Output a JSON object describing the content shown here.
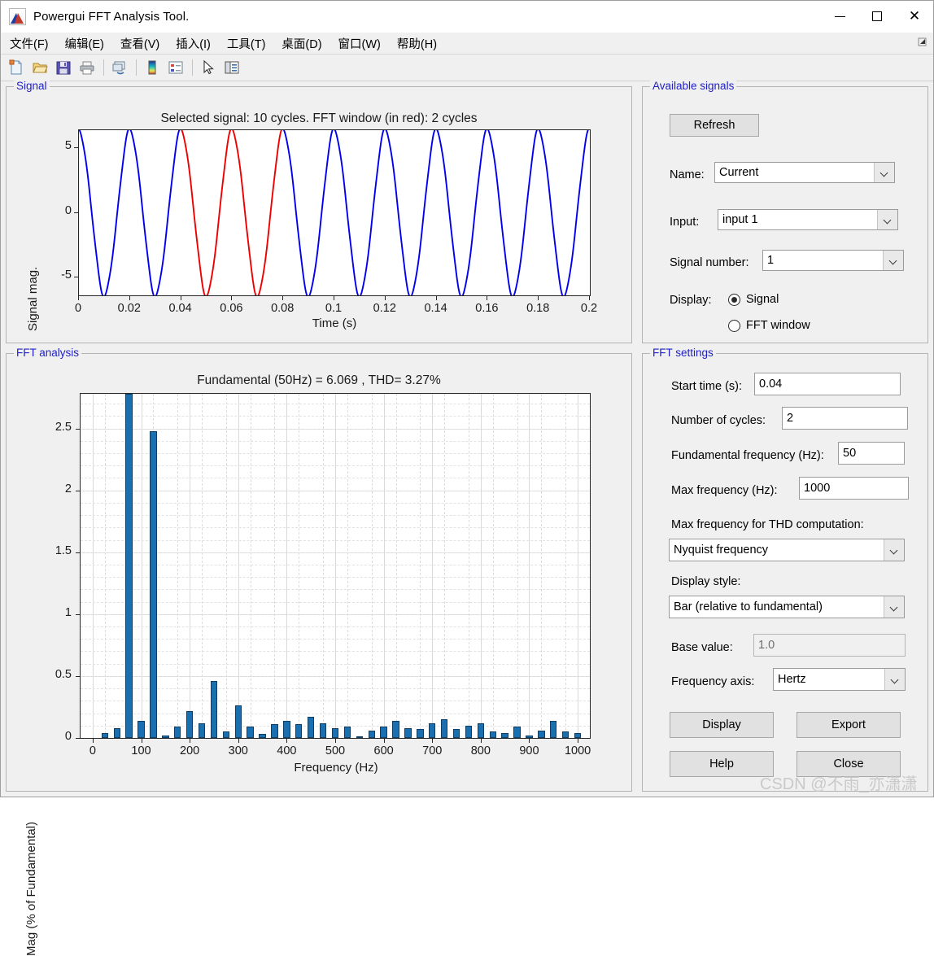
{
  "window": {
    "title": "Powergui FFT Analysis Tool.",
    "app_icon": "matlab-icon",
    "minimize": "minimize-icon",
    "maximize": "maximize-icon",
    "close": "close-icon"
  },
  "menubar": {
    "items": [
      {
        "label": "文件(F)",
        "mnemonic": "F"
      },
      {
        "label": "编辑(E)",
        "mnemonic": "E"
      },
      {
        "label": "查看(V)",
        "mnemonic": "V"
      },
      {
        "label": "插入(I)",
        "mnemonic": "I"
      },
      {
        "label": "工具(T)",
        "mnemonic": "T"
      },
      {
        "label": "桌面(D)",
        "mnemonic": "D"
      },
      {
        "label": "窗口(W)",
        "mnemonic": "W"
      },
      {
        "label": "帮助(H)",
        "mnemonic": "H"
      }
    ],
    "dock_icon": "dock-arrow-icon"
  },
  "toolbar": {
    "buttons": [
      {
        "name": "new-figure-icon"
      },
      {
        "name": "open-file-icon"
      },
      {
        "name": "save-figure-icon"
      },
      {
        "name": "print-figure-icon"
      },
      {
        "name": "link-plot-icon"
      },
      {
        "name": "colorbar-icon"
      },
      {
        "name": "legend-icon"
      },
      {
        "name": "pointer-icon"
      },
      {
        "name": "plot-browser-icon"
      }
    ]
  },
  "signal_panel": {
    "title": "Signal"
  },
  "fft_panel": {
    "title": "FFT analysis"
  },
  "available_signals": {
    "title": "Available signals",
    "refresh_label": "Refresh",
    "name_label": "Name:",
    "name_value": "Current",
    "input_label": "Input:",
    "input_value": "input 1",
    "signal_number_label": "Signal number:",
    "signal_number_value": "1",
    "display_label": "Display:",
    "radio_signal": "Signal",
    "radio_fft_window": "FFT window",
    "selected": "Signal"
  },
  "fft_settings": {
    "title": "FFT settings",
    "start_time_label": "Start time (s):",
    "start_time_value": "0.04",
    "num_cycles_label": "Number of cycles:",
    "num_cycles_value": "2",
    "fundamental_label": "Fundamental frequency (Hz):",
    "fundamental_value": "50",
    "max_freq_label": "Max frequency (Hz):",
    "max_freq_value": "1000",
    "max_freq_thd_label": "Max frequency for THD computation:",
    "max_freq_thd_value": "Nyquist frequency",
    "display_style_label": "Display style:",
    "display_style_value": "Bar (relative to fundamental)",
    "base_value_label": "Base value:",
    "base_value_value": "1.0",
    "freq_axis_label": "Frequency axis:",
    "freq_axis_value": "Hertz",
    "display_button": "Display",
    "export_button": "Export",
    "help_button": "Help",
    "close_button": "Close"
  },
  "watermark": "CSDN @不雨_亦潇潇",
  "colors": {
    "signal_blue": "#0000ee",
    "fft_window_red": "#ee0000",
    "bar_fill": "#1a6fb0",
    "bar_edge": "#0d3d63",
    "panel_title": "#2020c8",
    "panel_bg": "#f0f0f0"
  },
  "chart_data": [
    {
      "type": "line",
      "name": "selected-signal",
      "title": "Selected signal: 10 cycles. FFT window (in red): 2 cycles",
      "xlabel": "Time (s)",
      "ylabel": "Signal mag.",
      "xlim": [
        0,
        0.2
      ],
      "ylim": [
        -6.4,
        6.4
      ],
      "xticks": [
        0,
        0.02,
        0.04,
        0.06,
        0.08,
        0.1,
        0.12,
        0.14,
        0.16,
        0.18,
        0.2
      ],
      "xticklabels": [
        "0",
        "0.02",
        "0.04",
        "0.06",
        "0.08",
        "0.1",
        "0.12",
        "0.14",
        "0.16",
        "0.18",
        "0.2"
      ],
      "yticks": [
        -5,
        0,
        5
      ],
      "yticklabels": [
        "-5",
        "0",
        "5"
      ],
      "grid": false,
      "waveform": {
        "shape": "sine",
        "amplitude": 6.3,
        "frequency_hz": 50,
        "cycles": 10,
        "phase_deg": 90,
        "note": "cosine-like: starts near +5, first peak at t=0, harmonic distortion present"
      },
      "highlight_window": {
        "start": 0.04,
        "end": 0.08,
        "color": "#ee0000",
        "label": "FFT window (in red)"
      }
    },
    {
      "type": "bar",
      "name": "fft-spectrum",
      "title": "Fundamental (50Hz) = 6.069 , THD= 3.27%",
      "xlabel": "Frequency (Hz)",
      "ylabel": "Mag (% of Fundamental)",
      "xlim": [
        -25,
        1025
      ],
      "ylim": [
        0,
        2.78
      ],
      "xticks": [
        0,
        100,
        200,
        300,
        400,
        500,
        600,
        700,
        800,
        900,
        1000
      ],
      "xticklabels": [
        "0",
        "100",
        "200",
        "300",
        "400",
        "500",
        "600",
        "700",
        "800",
        "900",
        "1000"
      ],
      "yticks": [
        0,
        0.5,
        1,
        1.5,
        2,
        2.5
      ],
      "yticklabels": [
        "0",
        "0.5",
        "1",
        "1.5",
        "2",
        "2.5"
      ],
      "grid": true,
      "fundamental_hz": 50,
      "fundamental_magnitude": "6.069",
      "thd_percent": "3.27",
      "bar_width_hz": 14,
      "categories": [
        0,
        25,
        50,
        75,
        100,
        125,
        150,
        175,
        200,
        225,
        250,
        275,
        300,
        325,
        350,
        375,
        400,
        425,
        450,
        475,
        500,
        525,
        550,
        575,
        600,
        625,
        650,
        675,
        700,
        725,
        750,
        775,
        800,
        825,
        850,
        875,
        900,
        925,
        950,
        975,
        1000
      ],
      "values": [
        0.0,
        0.04,
        0.08,
        2.78,
        0.14,
        2.48,
        0.02,
        0.09,
        0.22,
        0.12,
        0.46,
        0.05,
        0.26,
        0.09,
        0.03,
        0.11,
        0.14,
        0.11,
        0.17,
        0.12,
        0.08,
        0.09,
        0.01,
        0.06,
        0.09,
        0.14,
        0.08,
        0.07,
        0.12,
        0.15,
        0.07,
        0.1,
        0.12,
        0.05,
        0.04,
        0.09,
        0.02,
        0.06,
        0.14,
        0.05,
        0.04
      ]
    }
  ]
}
